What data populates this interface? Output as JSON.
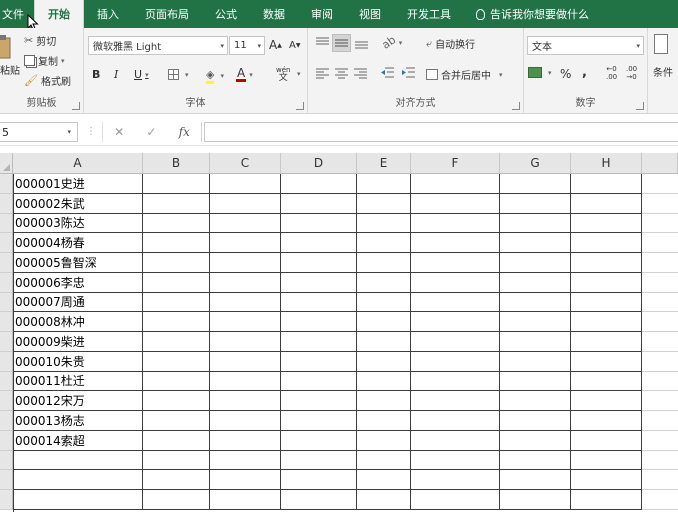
{
  "tabs": [
    "文件",
    "开始",
    "插入",
    "页面布局",
    "公式",
    "数据",
    "审阅",
    "视图",
    "开发工具"
  ],
  "active_tab": "开始",
  "tell_me": "告诉我你想要做什么",
  "clipboard": {
    "paste": "粘贴",
    "cut": "剪切",
    "copy": "复制",
    "format_painter": "格式刷",
    "label": "剪贴板"
  },
  "font": {
    "name": "微软雅黑 Light",
    "size": "11",
    "grow": "A",
    "shrink": "A",
    "bold": "B",
    "italic": "I",
    "underline": "U",
    "font_color": "A",
    "phonetic_top": "wén",
    "phonetic_bottom": "文",
    "label": "字体"
  },
  "alignment": {
    "wrap_text": "自动换行",
    "merge_center": "合并后居中",
    "label": "对齐方式"
  },
  "number": {
    "format": "文本",
    "percent": "%",
    "comma": ",",
    "inc_top": "←0",
    "inc_bottom": ".00",
    "dec_top": ".00",
    "dec_bottom": "→0",
    "label": "数字"
  },
  "styles_partial": "条件",
  "formula_bar": {
    "name_box": "5",
    "dots": "⋮",
    "cancel": "✕",
    "enter": "✓",
    "fx": "fx",
    "value": ""
  },
  "columns": [
    "A",
    "B",
    "C",
    "D",
    "E",
    "F",
    "G",
    "H"
  ],
  "rows_visible": 17,
  "column_a_values": [
    "000001史进",
    "000002朱武",
    "000003陈达",
    "000004杨春",
    "000005鲁智深",
    "000006李忠",
    "000007周通",
    "000008林冲",
    "000009柴进",
    "000010朱贵",
    "000011杜迁",
    "000012宋万",
    "000013杨志",
    "000014索超",
    "",
    "",
    ""
  ],
  "colors": {
    "brand": "#217346",
    "ribbon_bg": "#f3f3f3",
    "header_bg": "#e6e6e6",
    "font_color_bar": "#c00000"
  }
}
